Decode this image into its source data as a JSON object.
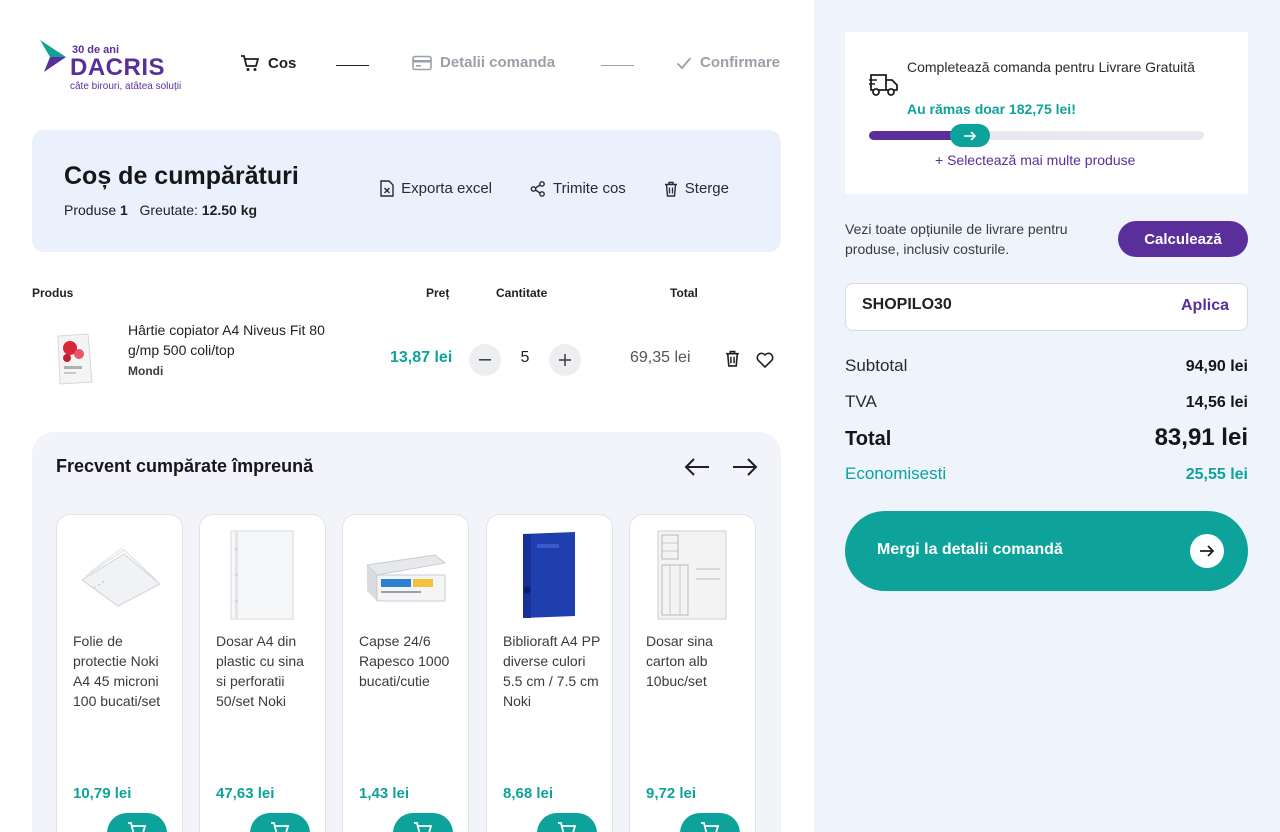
{
  "brand": {
    "anniversary": "30 de ani",
    "name": "DACRIS",
    "tagline": "câte birouri, atâtea soluții",
    "accent": "#5a2f9c",
    "teal": "#0ea39a"
  },
  "steps": [
    {
      "label": "Cos",
      "icon": "cart-icon",
      "state": "active"
    },
    {
      "label": "Detalii comanda",
      "icon": "card-icon",
      "state": "inactive"
    },
    {
      "label": "Confirmare",
      "icon": "check-icon",
      "state": "inactive"
    }
  ],
  "cart": {
    "title": "Coș de cumpărături",
    "products_label": "Produse",
    "products_count": "1",
    "weight_label": "Greutate:",
    "weight_value": "12.50 kg",
    "actions": {
      "export": "Exporta excel",
      "share": "Trimite cos",
      "delete": "Sterge"
    }
  },
  "table": {
    "headers": {
      "product": "Produs",
      "price": "Preț",
      "quantity": "Cantitate",
      "total": "Total"
    },
    "items": [
      {
        "name": "Hârtie copiator A4 Niveus Fit 80 g/mp 500 coli/top",
        "brand": "Mondi",
        "price": "13,87 lei",
        "quantity": "5",
        "total": "69,35 lei"
      }
    ]
  },
  "frequent": {
    "title": "Frecvent cumpărate împreună",
    "items": [
      {
        "name": "Folie de protectie Noki A4 45 microni 100 bucati/set",
        "price": "10,79 lei"
      },
      {
        "name": "Dosar A4 din plastic cu sina si perforatii 50/set Noki",
        "price": "47,63 lei"
      },
      {
        "name": "Capse 24/6 Rapesco 1000 bucati/cutie",
        "price": "1,43 lei"
      },
      {
        "name": "Biblioraft A4 PP diverse culori 5.5 cm / 7.5 cm Noki",
        "price": "8,68 lei"
      },
      {
        "name": "Dosar sina carton alb 10buc/set",
        "price": "9,72 lei"
      }
    ]
  },
  "shipping": {
    "message": "Completează comanda pentru Livrare Gratuită",
    "remaining": "Au rămas doar 182,75 lei!",
    "progress": 0.33,
    "more": "+ Selectează mai multe produse"
  },
  "delivery": {
    "text": "Vezi toate opțiunile de livrare pentru produse, inclusiv costurile.",
    "button": "Calculează"
  },
  "coupon": {
    "value": "SHOPILO30",
    "apply": "Aplica"
  },
  "summary": {
    "subtotal_label": "Subtotal",
    "subtotal": "94,90 lei",
    "tva_label": "TVA",
    "tva": "14,56 lei",
    "total_label": "Total",
    "total": "83,91 lei",
    "savings_label": "Economisesti",
    "savings": "25,55 lei"
  },
  "checkout": {
    "label": "Mergi la detalii comandă"
  }
}
